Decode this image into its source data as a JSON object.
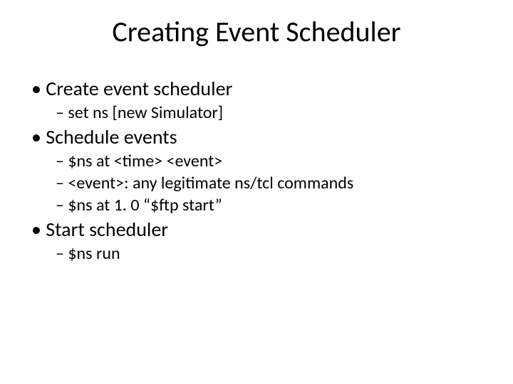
{
  "title": "Creating Event Scheduler",
  "items": {
    "b1_create": "Create event scheduler",
    "b2_setns": "set ns [new Simulator]",
    "b1_schedule": "Schedule events",
    "b2_nsat": "$ns at <time> <event>",
    "b2_event": "<event>: any legitimate ns/tcl commands",
    "b2_ftp": "$ns at 1. 0 “$ftp start”",
    "b1_start": "Start scheduler",
    "b2_run": "$ns run"
  }
}
